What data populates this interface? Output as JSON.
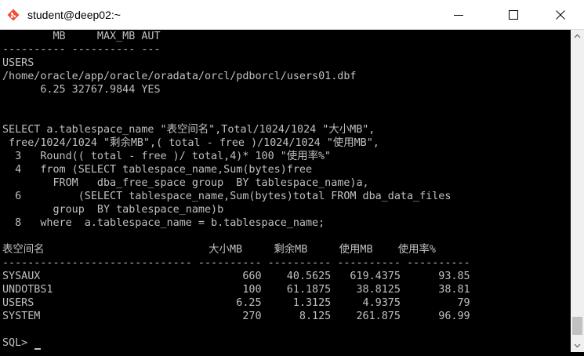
{
  "window": {
    "title": "student@deep02:~",
    "icon": "git-diamond-icon",
    "accent": "#f05133"
  },
  "terminal": {
    "lines": [
      "        MB     MAX_MB AUT",
      "---------- ---------- ---",
      "USERS",
      "/home/oracle/app/oracle/oradata/orcl/pdborcl/users01.dbf",
      "      6.25 32767.9844 YES",
      "",
      "",
      "SELECT a.tablespace_name \"表空间名\",Total/1024/1024 \"大小MB\",",
      " free/1024/1024 \"剩余MB\",( total - free )/1024/1024 \"使用MB\",",
      "  3   Round(( total - free )/ total,4)* 100 \"使用率%\"",
      "  4   from (SELECT tablespace_name,Sum(bytes)free",
      "        FROM   dba_free_space group  BY tablespace_name)a,",
      "  6         (SELECT tablespace_name,Sum(bytes)total FROM dba_data_files",
      "        group  BY tablespace_name)b",
      "  8   where  a.tablespace_name = b.tablespace_name;",
      "",
      "表空间名                          大小MB     剩余MB     使用MB    使用率%",
      "------------------------------ ---------- ---------- ---------- ----------",
      "SYSAUX                                660    40.5625   619.4375      93.85",
      "UNDOTBS1                              100    61.1875    38.8125      38.81",
      "USERS                                6.25     1.3125     4.9375         79",
      "SYSTEM                                270      8.125    261.875      96.99",
      "",
      "SQL> "
    ]
  },
  "icons": {
    "minimize": "minimize-icon",
    "maximize": "maximize-icon",
    "close": "close-icon",
    "scroll_up": "chevron-up-icon",
    "scroll_down": "chevron-down-icon"
  },
  "colors": {
    "terminal_bg": "#000000",
    "terminal_fg": "#c0c0c0",
    "titlebar_bg": "#ffffff"
  }
}
